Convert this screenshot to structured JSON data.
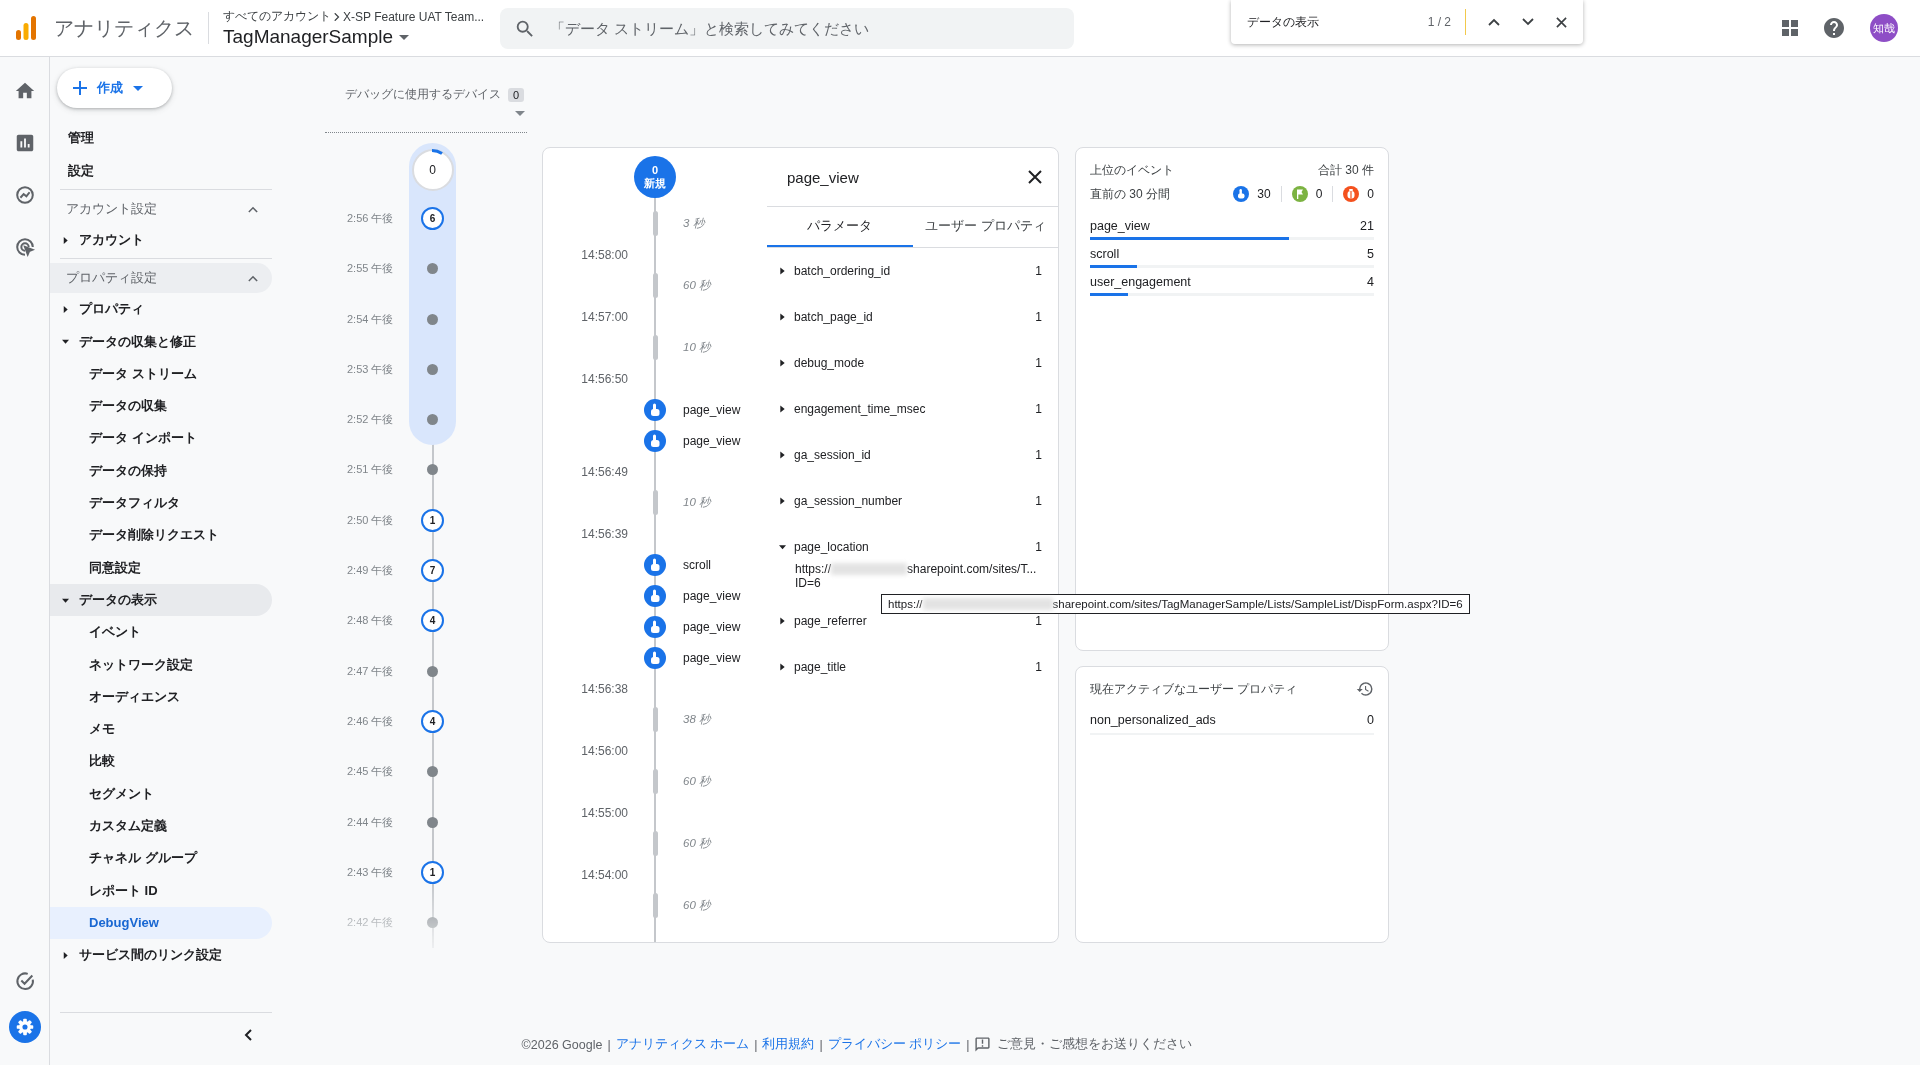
{
  "topbar": {
    "product": "アナリティクス",
    "breadcrumb": [
      "すべてのアカウント",
      "X-SP Feature UAT Team..."
    ],
    "property": "TagManagerSample",
    "search": {
      "placeholder": "「データ ストリーム」と検索してみてください"
    },
    "avatar": "知哉"
  },
  "find_bar": {
    "query": "データの表示",
    "count": "1 / 2"
  },
  "rail_top": [
    {
      "kind": "home",
      "selected": false
    },
    {
      "kind": "reports",
      "selected": false
    },
    {
      "kind": "explore",
      "selected": false
    },
    {
      "kind": "advertising",
      "selected": false
    }
  ],
  "rail_bottom": [
    {
      "kind": "check",
      "selected": false
    },
    {
      "kind": "admin",
      "selected": true
    }
  ],
  "sidebar": {
    "create_button": "作成",
    "top_items": [
      "管理",
      "設定"
    ],
    "sections": [
      {
        "title": "アカウント設定",
        "expanded": true,
        "highlighted": false,
        "items": [
          {
            "label": "アカウント",
            "expanded": false,
            "selected": false
          }
        ]
      },
      {
        "title": "プロパティ設定",
        "expanded": true,
        "highlighted": true,
        "items": [
          {
            "label": "プロパティ",
            "expanded": false,
            "selected": false
          },
          {
            "label": "データの収集と修正",
            "expanded": true,
            "selected": false,
            "children": [
              {
                "label": "データ ストリーム",
                "selected": false
              },
              {
                "label": "データの収集",
                "selected": false
              },
              {
                "label": "データ インポート",
                "selected": false
              },
              {
                "label": "データの保持",
                "selected": false
              },
              {
                "label": "データフィルタ",
                "selected": false
              },
              {
                "label": "データ削除リクエスト",
                "selected": false
              },
              {
                "label": "同意設定",
                "selected": false
              }
            ]
          },
          {
            "label": "データの表示",
            "expanded": true,
            "selected": false,
            "children": [
              {
                "label": "イベント",
                "selected": false
              },
              {
                "label": "ネットワーク設定",
                "selected": false
              },
              {
                "label": "オーディエンス",
                "selected": false
              },
              {
                "label": "メモ",
                "selected": false
              },
              {
                "label": "比較",
                "selected": false
              },
              {
                "label": "セグメント",
                "selected": false
              },
              {
                "label": "カスタム定義",
                "selected": false
              },
              {
                "label": "チャネル グループ",
                "selected": false
              },
              {
                "label": "レポート ID",
                "selected": false
              },
              {
                "label": "DebugView",
                "selected": true
              }
            ]
          },
          {
            "label": "サービス間のリンク設定",
            "expanded": false,
            "selected": false
          }
        ]
      }
    ]
  },
  "device_selector": {
    "label": "デバッグに使用するデバイス",
    "count": "0"
  },
  "minute_timeline": {
    "current": "0",
    "minutes": [
      {
        "time": "2:56 午後",
        "kind": "count",
        "count": "6",
        "in_window": true
      },
      {
        "time": "2:55 午後",
        "kind": "dot",
        "in_window": true
      },
      {
        "time": "2:54 午後",
        "kind": "dot",
        "in_window": true
      },
      {
        "time": "2:53 午後",
        "kind": "dot",
        "in_window": true
      },
      {
        "time": "2:52 午後",
        "kind": "dot",
        "in_window": true
      },
      {
        "time": "2:51 午後",
        "kind": "dot",
        "in_window": false
      },
      {
        "time": "2:50 午後",
        "kind": "count",
        "count": "1",
        "in_window": false
      },
      {
        "time": "2:49 午後",
        "kind": "count",
        "count": "7",
        "in_window": false
      },
      {
        "time": "2:48 午後",
        "kind": "count",
        "count": "4",
        "in_window": false
      },
      {
        "time": "2:47 午後",
        "kind": "dot",
        "in_window": false
      },
      {
        "time": "2:46 午後",
        "kind": "count",
        "count": "4",
        "in_window": false
      },
      {
        "time": "2:45 午後",
        "kind": "dot",
        "in_window": false
      },
      {
        "time": "2:44 午後",
        "kind": "dot",
        "in_window": false
      },
      {
        "time": "2:43 午後",
        "kind": "count",
        "count": "1",
        "in_window": false
      },
      {
        "time": "2:42 午後",
        "kind": "dot",
        "in_window": false
      }
    ]
  },
  "stream": {
    "new_count": "0",
    "new_label": "新規",
    "rows": [
      {
        "kind": "gap",
        "text": "3 秒"
      },
      {
        "kind": "time",
        "text": "14:58:00"
      },
      {
        "kind": "gap",
        "text": "60 秒"
      },
      {
        "kind": "time",
        "text": "14:57:00"
      },
      {
        "kind": "gap",
        "text": "10 秒"
      },
      {
        "kind": "time",
        "text": "14:56:50"
      },
      {
        "kind": "event",
        "text": "page_view"
      },
      {
        "kind": "event",
        "text": "page_view"
      },
      {
        "kind": "time",
        "text": "14:56:49"
      },
      {
        "kind": "gap",
        "text": "10 秒"
      },
      {
        "kind": "time",
        "text": "14:56:39"
      },
      {
        "kind": "event",
        "text": "scroll"
      },
      {
        "kind": "event",
        "text": "page_view"
      },
      {
        "kind": "event",
        "text": "page_view"
      },
      {
        "kind": "event",
        "text": "page_view"
      },
      {
        "kind": "time",
        "text": "14:56:38"
      },
      {
        "kind": "gap",
        "text": "38 秒"
      },
      {
        "kind": "time",
        "text": "14:56:00"
      },
      {
        "kind": "gap",
        "text": "60 秒"
      },
      {
        "kind": "time",
        "text": "14:55:00"
      },
      {
        "kind": "gap",
        "text": "60 秒"
      },
      {
        "kind": "time",
        "text": "14:54:00"
      },
      {
        "kind": "gap",
        "text": "60 秒"
      }
    ]
  },
  "event_detail": {
    "title": "page_view",
    "tabs": [
      {
        "label": "パラメータ",
        "selected": true
      },
      {
        "label": "ユーザー プロパティ",
        "selected": false
      }
    ],
    "params": [
      {
        "name": "batch_ordering_id",
        "count": "1",
        "expanded": false
      },
      {
        "name": "batch_page_id",
        "count": "1",
        "expanded": false
      },
      {
        "name": "debug_mode",
        "count": "1",
        "expanded": false
      },
      {
        "name": "engagement_time_msec",
        "count": "1",
        "expanded": false
      },
      {
        "name": "ga_session_id",
        "count": "1",
        "expanded": false
      },
      {
        "name": "ga_session_number",
        "count": "1",
        "expanded": false
      },
      {
        "name": "page_location",
        "count": "1",
        "expanded": true,
        "value_start": "https://",
        "value_end": "sharepoint.com/sites/T...",
        "value_line2": "ID=6"
      },
      {
        "name": "page_referrer",
        "count": "1",
        "expanded": false
      },
      {
        "name": "page_title",
        "count": "1",
        "expanded": false
      }
    ],
    "tooltip": {
      "start": "https://",
      "end": "sharepoint.com/sites/TagManagerSample/Lists/SampleList/DispForm.aspx?ID=6"
    }
  },
  "top_events": {
    "title": "上位のイベント",
    "total": "合計 30 件",
    "period": "直前の 30 分間",
    "counters": [
      {
        "kind": "event",
        "value": "30"
      },
      {
        "kind": "key_event",
        "value": "0"
      },
      {
        "kind": "error",
        "value": "0"
      }
    ],
    "events": [
      {
        "name": "page_view",
        "count": "21",
        "level": 0.7
      },
      {
        "name": "scroll",
        "count": "5",
        "level": 0.167
      },
      {
        "name": "user_engagement",
        "count": "4",
        "level": 0.133
      }
    ]
  },
  "user_properties": {
    "title": "現在アクティブなユーザー プロパティ",
    "rows": [
      {
        "name": "non_personalized_ads",
        "value": "0"
      }
    ]
  },
  "footer": {
    "copyright": "©2026 Google",
    "separator": "|",
    "links": [
      "アナリティクス ホーム",
      "利用規約",
      "プライバシー ポリシー"
    ],
    "feedback": "ご意見・ご感想をお送りください"
  }
}
